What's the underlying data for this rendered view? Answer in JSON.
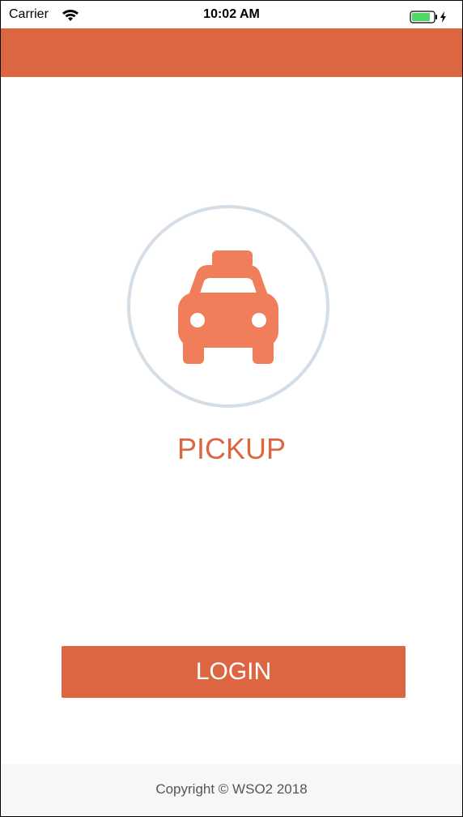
{
  "status_bar": {
    "carrier": "Carrier",
    "time": "10:02 AM",
    "wifi_icon": "wifi-icon",
    "battery_icon": "battery-charging-icon",
    "battery_color": "#4cd964"
  },
  "header": {
    "color": "#dc6642"
  },
  "logo": {
    "icon": "taxi-icon",
    "icon_color": "#f07e5a",
    "ring_color": "#d5dde6"
  },
  "app_title": "PICKUP",
  "login_button": {
    "label": "LOGIN"
  },
  "footer": {
    "copyright": "Copyright ©  WSO2 2018"
  }
}
